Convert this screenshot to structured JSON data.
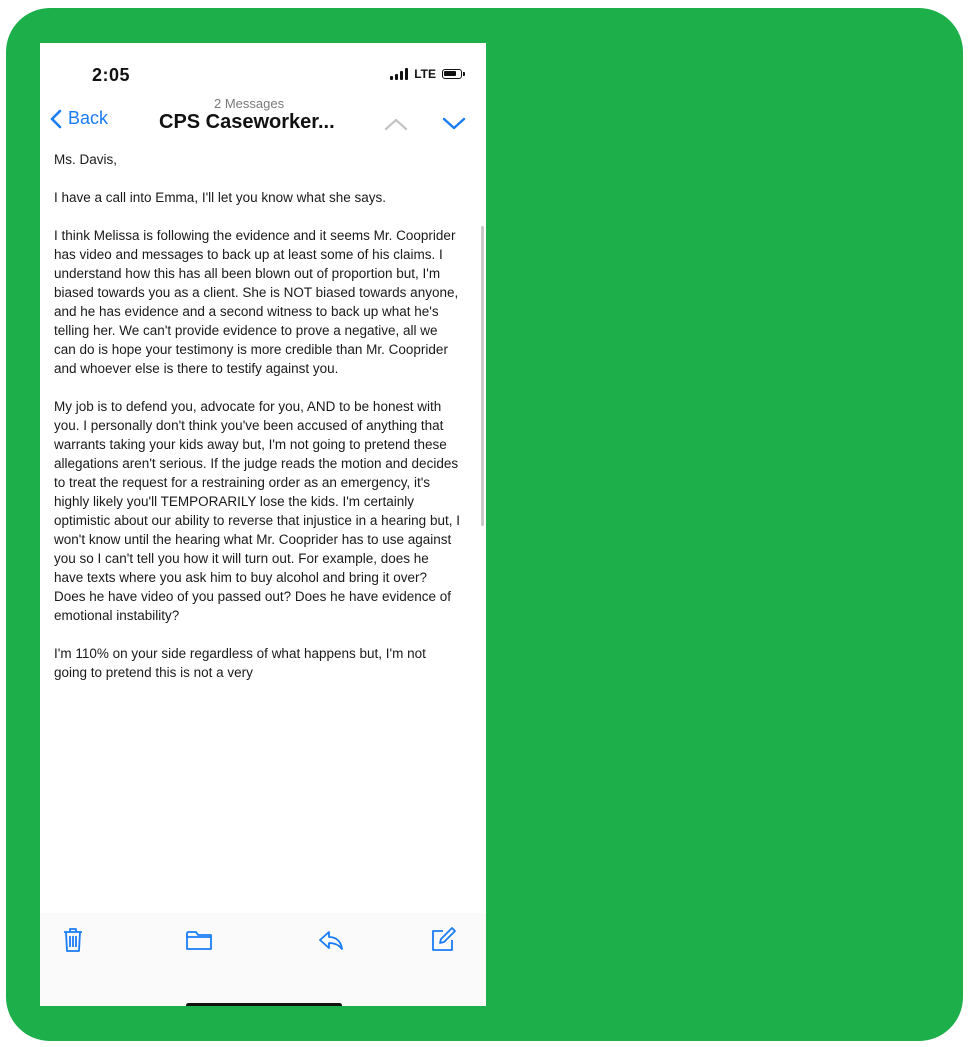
{
  "status_bar": {
    "time": "2:05",
    "network": "LTE",
    "icons": [
      "signal-icon",
      "battery-icon"
    ]
  },
  "nav": {
    "back_label": "Back",
    "message_count": "2 Messages",
    "title": "CPS Caseworker...",
    "icons": [
      "chevron-left-icon",
      "chevron-up-icon",
      "chevron-down-icon"
    ]
  },
  "email": {
    "paragraphs": [
      "Ms. Davis,",
      "I have a call into Emma, I'll let you know what she says.",
      "I think Melissa is following the evidence and it seems Mr. Cooprider has video and messages to back up at least some of his claims. I understand how this has all been blown out of proportion but, I'm biased towards you as a client. She is NOT biased towards anyone, and he has evidence and a second witness to back up what he's telling her. We can't provide evidence to prove a negative, all we can do is hope your testimony is more credible than Mr. Cooprider and whoever else is there to testify against you.",
      "My job is to defend you, advocate for you, AND to be honest with you. I personally don't think you've been accused of anything that warrants taking your kids away but, I'm not going to pretend these allegations aren't serious. If the judge reads the motion and decides to treat the request for a restraining order as an emergency, it's highly likely you'll TEMPORARILY lose the kids. I'm certainly optimistic about our ability to reverse that injustice in a hearing but, I won't know until the hearing what Mr. Cooprider has to use against you so I can't tell you how it will turn out. For example, does he have texts where you ask him to buy alcohol and bring it over? Does he have video of you passed out? Does he have evidence of emotional instability?",
      "I'm 110% on your side regardless of what happens but, I'm not going to pretend this is not a very"
    ]
  },
  "toolbar": {
    "icons": [
      "trash-icon",
      "folder-icon",
      "reply-icon",
      "compose-icon"
    ]
  },
  "colors": {
    "frame_green": "#1daf4a",
    "ios_blue": "#1a7cf5",
    "text": "#1a1a1a"
  }
}
